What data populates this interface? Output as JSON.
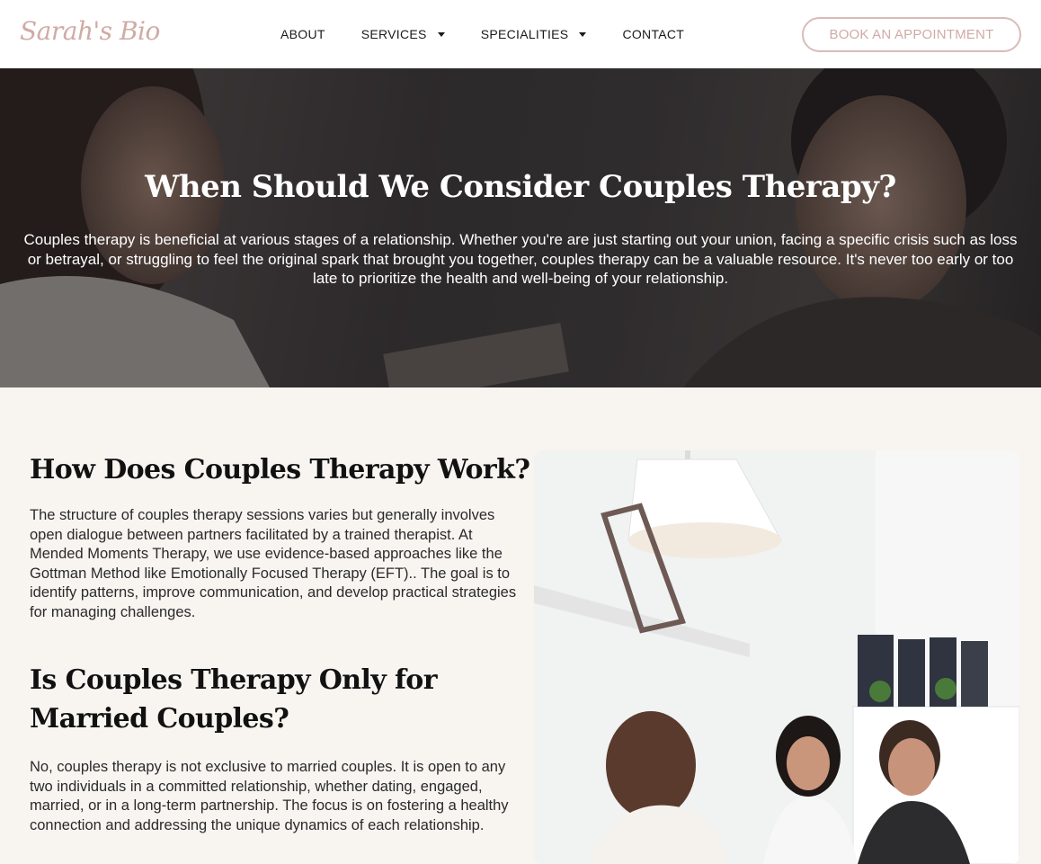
{
  "header": {
    "logo_text": "Sarah's Bio",
    "nav": [
      {
        "label": "ABOUT",
        "has_dropdown": false
      },
      {
        "label": "SERVICES",
        "has_dropdown": true
      },
      {
        "label": "SPECIALITIES",
        "has_dropdown": true
      },
      {
        "label": "CONTACT",
        "has_dropdown": false
      }
    ],
    "cta_label": "BOOK AN APPOINTMENT"
  },
  "hero": {
    "title": "When Should We Consider Couples Therapy?",
    "text": "Couples therapy is beneficial at various stages of a relationship. Whether you're are just starting out your union, facing a specific crisis such as loss or betrayal, or struggling to feel the original spark that brought you together, couples therapy can be a valuable resource. It's never too early or too late to prioritize the health and well-being of your relationship."
  },
  "sections": [
    {
      "heading": "How Does Couples Therapy Work?",
      "body": "The structure of couples therapy sessions varies but generally involves open dialogue between partners facilitated by a trained therapist. At Mended Moments Therapy, we use evidence-based approaches like the Gottman Method like Emotionally Focused Therapy (EFT).. The goal is to identify patterns, improve communication, and develop practical strategies for managing challenges."
    },
    {
      "heading": "Is Couples Therapy Only for Married Couples?",
      "body": "No, couples therapy is not exclusive to married couples. It is open to any two individuals in a committed relationship, whether dating, engaged, married, or in a long-term partnership. The focus is on fostering a healthy connection and addressing the unique dynamics of each relationship."
    }
  ],
  "colors": {
    "brand_pink": "#d0aaa5",
    "page_bg": "#f8f5f1"
  }
}
